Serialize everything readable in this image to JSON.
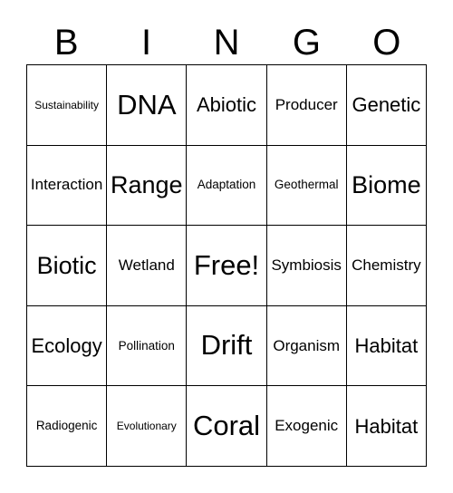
{
  "card": {
    "header_letters": [
      "B",
      "I",
      "N",
      "G",
      "O"
    ],
    "columns": 5,
    "rows": 5,
    "free_space_label": "Free!",
    "colors": {
      "background": "#ffffff",
      "text": "#000000",
      "grid_line": "#000000"
    },
    "cells": [
      [
        {
          "label": "Sustainability",
          "size": "xs"
        },
        {
          "label": "DNA",
          "size": "xxl"
        },
        {
          "label": "Abiotic",
          "size": "l"
        },
        {
          "label": "Producer",
          "size": "m"
        },
        {
          "label": "Genetic",
          "size": "l"
        }
      ],
      [
        {
          "label": "Interaction",
          "size": "m"
        },
        {
          "label": "Range",
          "size": "xl"
        },
        {
          "label": "Adaptation",
          "size": "s"
        },
        {
          "label": "Geothermal",
          "size": "s"
        },
        {
          "label": "Biome",
          "size": "xl"
        }
      ],
      [
        {
          "label": "Biotic",
          "size": "xl"
        },
        {
          "label": "Wetland",
          "size": "m"
        },
        {
          "label": "Free!",
          "size": "xxl"
        },
        {
          "label": "Symbiosis",
          "size": "m"
        },
        {
          "label": "Chemistry",
          "size": "m"
        }
      ],
      [
        {
          "label": "Ecology",
          "size": "l"
        },
        {
          "label": "Pollination",
          "size": "s"
        },
        {
          "label": "Drift",
          "size": "xxl"
        },
        {
          "label": "Organism",
          "size": "m"
        },
        {
          "label": "Habitat",
          "size": "l"
        }
      ],
      [
        {
          "label": "Radiogenic",
          "size": "s"
        },
        {
          "label": "Evolutionary",
          "size": "xs"
        },
        {
          "label": "Coral",
          "size": "xxl"
        },
        {
          "label": "Exogenic",
          "size": "m"
        },
        {
          "label": "Habitat",
          "size": "l"
        }
      ]
    ]
  }
}
